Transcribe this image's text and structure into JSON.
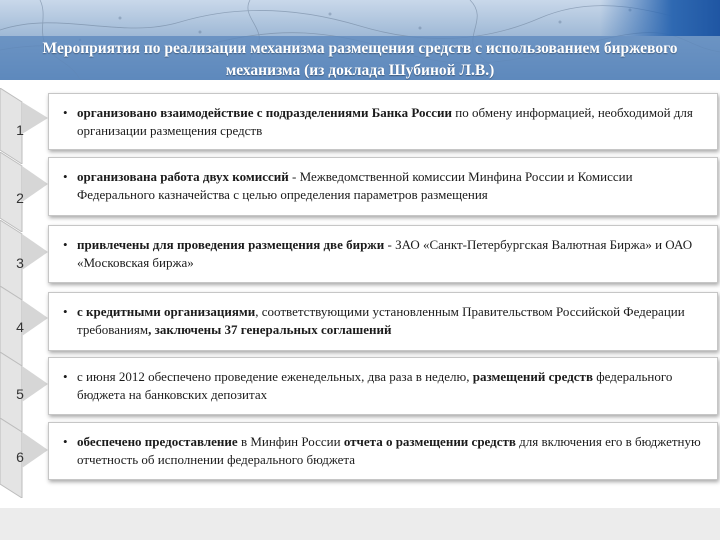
{
  "slide": {
    "title": "Мероприятия по реализации механизма размещения средств с использованием биржевого механизма (из доклада Шубиной Л.В.)"
  },
  "items": [
    {
      "number": "1",
      "bullet": "•",
      "bold_1": "организовано взаимодействие с подразделениями Банка России",
      "text_1": " по обмену информацией, необходимой для организации размещения средств"
    },
    {
      "number": "2",
      "bullet": "•",
      "bold_1": "организована работа двух комиссий",
      "text_1": " - Межведомственной комиссии Минфина России и Комиссии Федерального казначейства с целью определения параметров размещения"
    },
    {
      "number": "3",
      "bullet": "•",
      "bold_1": "привлечены для проведения размещения две биржи",
      "text_1": " - ЗАО «Санкт-Петербургская Валютная Биржа» и ОАО «Московская биржа»"
    },
    {
      "number": "4",
      "bullet": "•",
      "bold_1": "с кредитными организациями",
      "text_1": ", соответствующими установленным Правительством Российской Федерации требованиям",
      "bold_2": ", заключены 37 генеральных соглашений"
    },
    {
      "number": "5",
      "bullet": "•",
      "text_0": "с июня 2012 обеспечено проведение еженедельных, два раза в неделю, ",
      "bold_1": "размещений средств",
      "text_1": " федерального бюджета на банковских депозитах"
    },
    {
      "number": "6",
      "bullet": "•",
      "bold_1": "обеспечено предоставление",
      "text_1": " в Минфин России ",
      "bold_2": "отчета о размещении средств",
      "text_2": " для включения его в бюджетную отчетность об исполнении федерального бюджета"
    }
  ]
}
